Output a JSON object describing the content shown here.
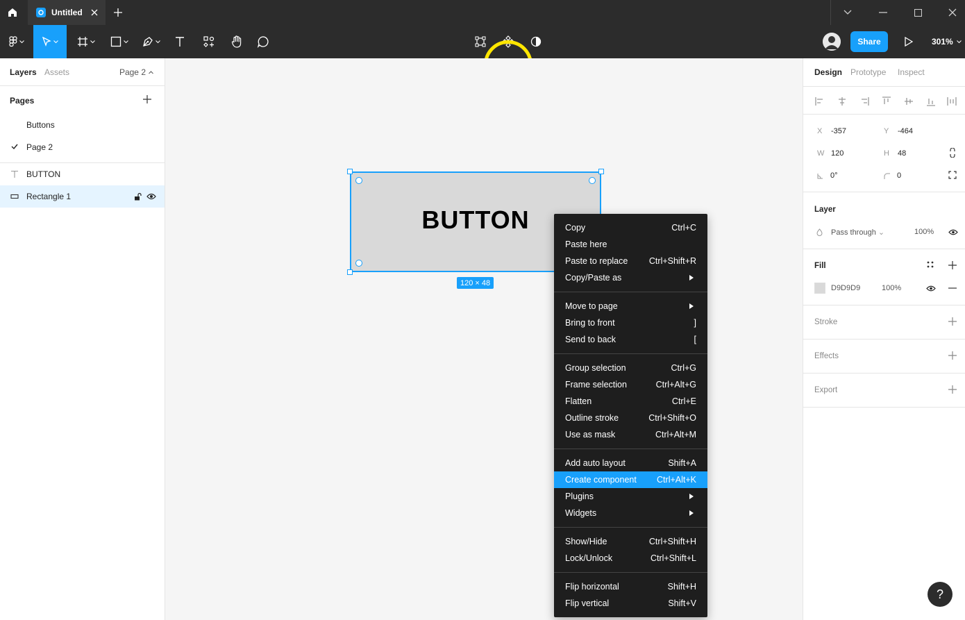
{
  "titlebar": {
    "tab_title": "Untitled"
  },
  "toolbar": {
    "share_label": "Share",
    "zoom_label": "301%",
    "icons": [
      "figma-menu-icon",
      "move-icon",
      "frame-icon",
      "rectangle-icon",
      "pen-icon",
      "text-icon",
      "resources-icon",
      "hand-icon",
      "comment-icon",
      "edit-object-icon",
      "create-component-icon",
      "mask-icon",
      "play-icon"
    ]
  },
  "left_panel": {
    "tabs": {
      "layers": "Layers",
      "assets": "Assets"
    },
    "current_page": "Page 2",
    "pages_label": "Pages",
    "pages": [
      {
        "label": "Buttons",
        "selected": false
      },
      {
        "label": "Page 2",
        "selected": true
      }
    ],
    "layers": [
      {
        "label": "BUTTON",
        "type": "text"
      },
      {
        "label": "Rectangle 1",
        "type": "rectangle",
        "selected": true
      }
    ]
  },
  "canvas": {
    "rect_text": "BUTTON",
    "size_badge": "120 × 48",
    "rect_color": "#D9D9D9"
  },
  "context_menu": {
    "groups": [
      [
        {
          "label": "Copy",
          "shortcut": "Ctrl+C"
        },
        {
          "label": "Paste here",
          "shortcut": ""
        },
        {
          "label": "Paste to replace",
          "shortcut": "Ctrl+Shift+R"
        },
        {
          "label": "Copy/Paste as",
          "shortcut": "",
          "submenu": true
        }
      ],
      [
        {
          "label": "Move to page",
          "shortcut": "",
          "submenu": true
        },
        {
          "label": "Bring to front",
          "shortcut": "]"
        },
        {
          "label": "Send to back",
          "shortcut": "["
        }
      ],
      [
        {
          "label": "Group selection",
          "shortcut": "Ctrl+G"
        },
        {
          "label": "Frame selection",
          "shortcut": "Ctrl+Alt+G"
        },
        {
          "label": "Flatten",
          "shortcut": "Ctrl+E"
        },
        {
          "label": "Outline stroke",
          "shortcut": "Ctrl+Shift+O"
        },
        {
          "label": "Use as mask",
          "shortcut": "Ctrl+Alt+M"
        }
      ],
      [
        {
          "label": "Add auto layout",
          "shortcut": "Shift+A"
        },
        {
          "label": "Create component",
          "shortcut": "Ctrl+Alt+K",
          "highlighted": true
        },
        {
          "label": "Plugins",
          "shortcut": "",
          "submenu": true
        },
        {
          "label": "Widgets",
          "shortcut": "",
          "submenu": true
        }
      ],
      [
        {
          "label": "Show/Hide",
          "shortcut": "Ctrl+Shift+H"
        },
        {
          "label": "Lock/Unlock",
          "shortcut": "Ctrl+Shift+L"
        }
      ],
      [
        {
          "label": "Flip horizontal",
          "shortcut": "Shift+H"
        },
        {
          "label": "Flip vertical",
          "shortcut": "Shift+V"
        }
      ]
    ]
  },
  "right_panel": {
    "tabs": {
      "design": "Design",
      "prototype": "Prototype",
      "inspect": "Inspect"
    },
    "props": {
      "x_label": "X",
      "x": "-357",
      "y_label": "Y",
      "y": "-464",
      "w_label": "W",
      "w": "120",
      "h_label": "H",
      "h": "48",
      "rotation": "0°",
      "radius": "0"
    },
    "layer": {
      "title": "Layer",
      "blend": "Pass through",
      "opacity": "100%"
    },
    "fill": {
      "title": "Fill",
      "hex": "D9D9D9",
      "opacity": "100%"
    },
    "stroke": {
      "title": "Stroke"
    },
    "effects": {
      "title": "Effects"
    },
    "export": {
      "title": "Export"
    }
  },
  "help_label": "?",
  "accent_color": "#18A0FB",
  "highlight_color": "#FFE600"
}
